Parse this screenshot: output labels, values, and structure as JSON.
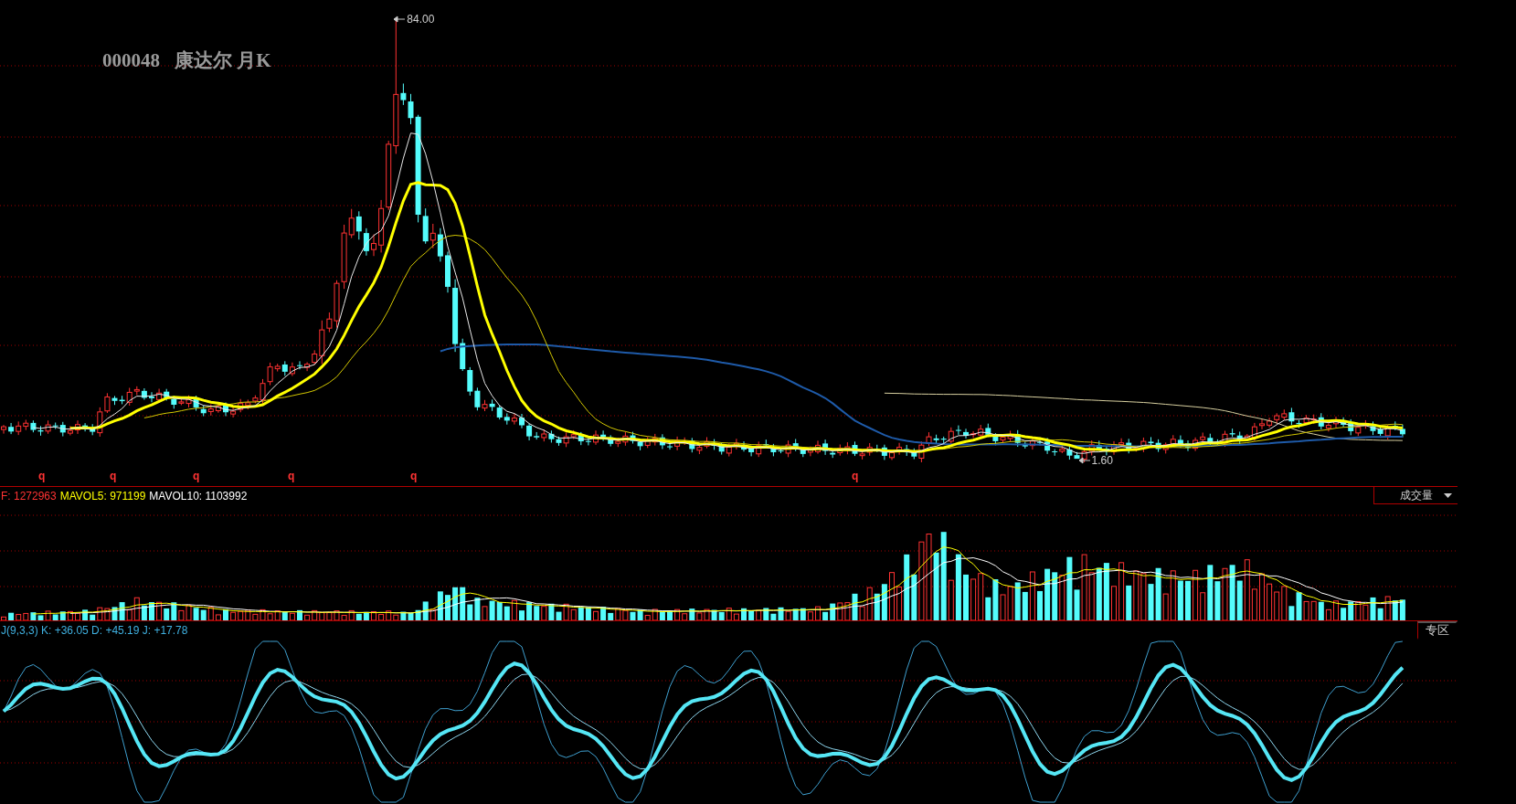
{
  "title": {
    "code": "000048",
    "name": "康达尔 月K"
  },
  "main_chart": {
    "high_label": "84.00",
    "low_label": "1.60",
    "signals": [
      "q",
      "q",
      "q",
      "q",
      "q",
      "q"
    ]
  },
  "volume_panel": {
    "legend": [
      {
        "text": "F: 1272963",
        "color": "#ff3333"
      },
      {
        "text": "MAVOL5: 971199",
        "color": "#ffff00"
      },
      {
        "text": "MAVOL10: 1103992",
        "color": "#ffffff"
      }
    ],
    "selector": "成交量"
  },
  "kdj_panel": {
    "legend": "J(9,3,3) K: +36.05 D: +45.19 J: +17.78",
    "button": "专区"
  }
}
